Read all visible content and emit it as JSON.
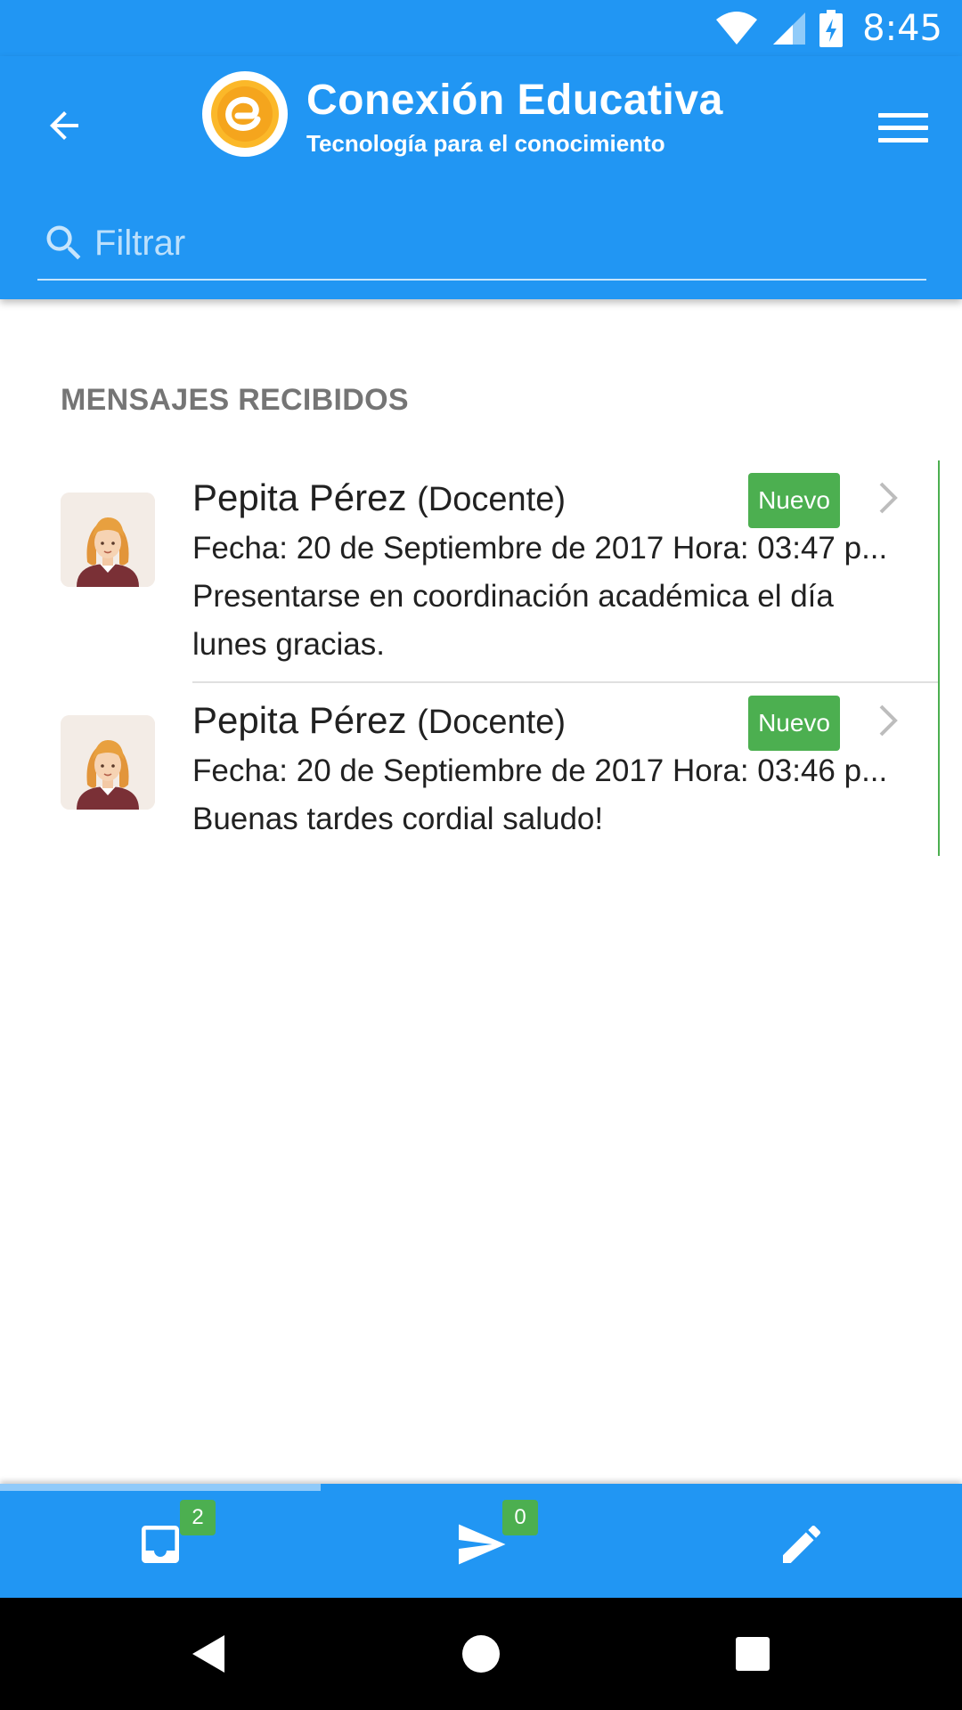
{
  "status_bar": {
    "time": "8:45",
    "icons": [
      "wifi-icon",
      "signal-icon",
      "battery-charging-icon"
    ]
  },
  "header": {
    "title": "Conexión Educativa",
    "subtitle": "Tecnología para el conocimiento",
    "back_icon": "arrow-left-icon",
    "menu_icon": "hamburger-menu-icon",
    "logo_icon": "conexion-educativa-logo"
  },
  "filter": {
    "placeholder": "Filtrar",
    "value": ""
  },
  "section_title": "MENSAJES RECIBIDOS",
  "messages": [
    {
      "sender": "Pepita Pérez",
      "role": "(Docente)",
      "badge": "Nuevo",
      "date": "Fecha: 20 de Septiembre de 2017 Hora: 03:47 p...",
      "text": "Presentarse en coordinación académica el día lunes gracias."
    },
    {
      "sender": "Pepita Pérez",
      "role": "(Docente)",
      "badge": "Nuevo",
      "date": "Fecha: 20 de Septiembre de 2017 Hora: 03:46 p...",
      "text": "Buenas tardes cordial saludo!"
    }
  ],
  "tabs": [
    {
      "icon": "inbox-icon",
      "badge": "2"
    },
    {
      "icon": "send-icon",
      "badge": "0"
    },
    {
      "icon": "pencil-icon",
      "badge": ""
    }
  ],
  "colors": {
    "primary": "#2196F3",
    "badge_green": "#4CAF50",
    "section_gray": "#757575"
  }
}
